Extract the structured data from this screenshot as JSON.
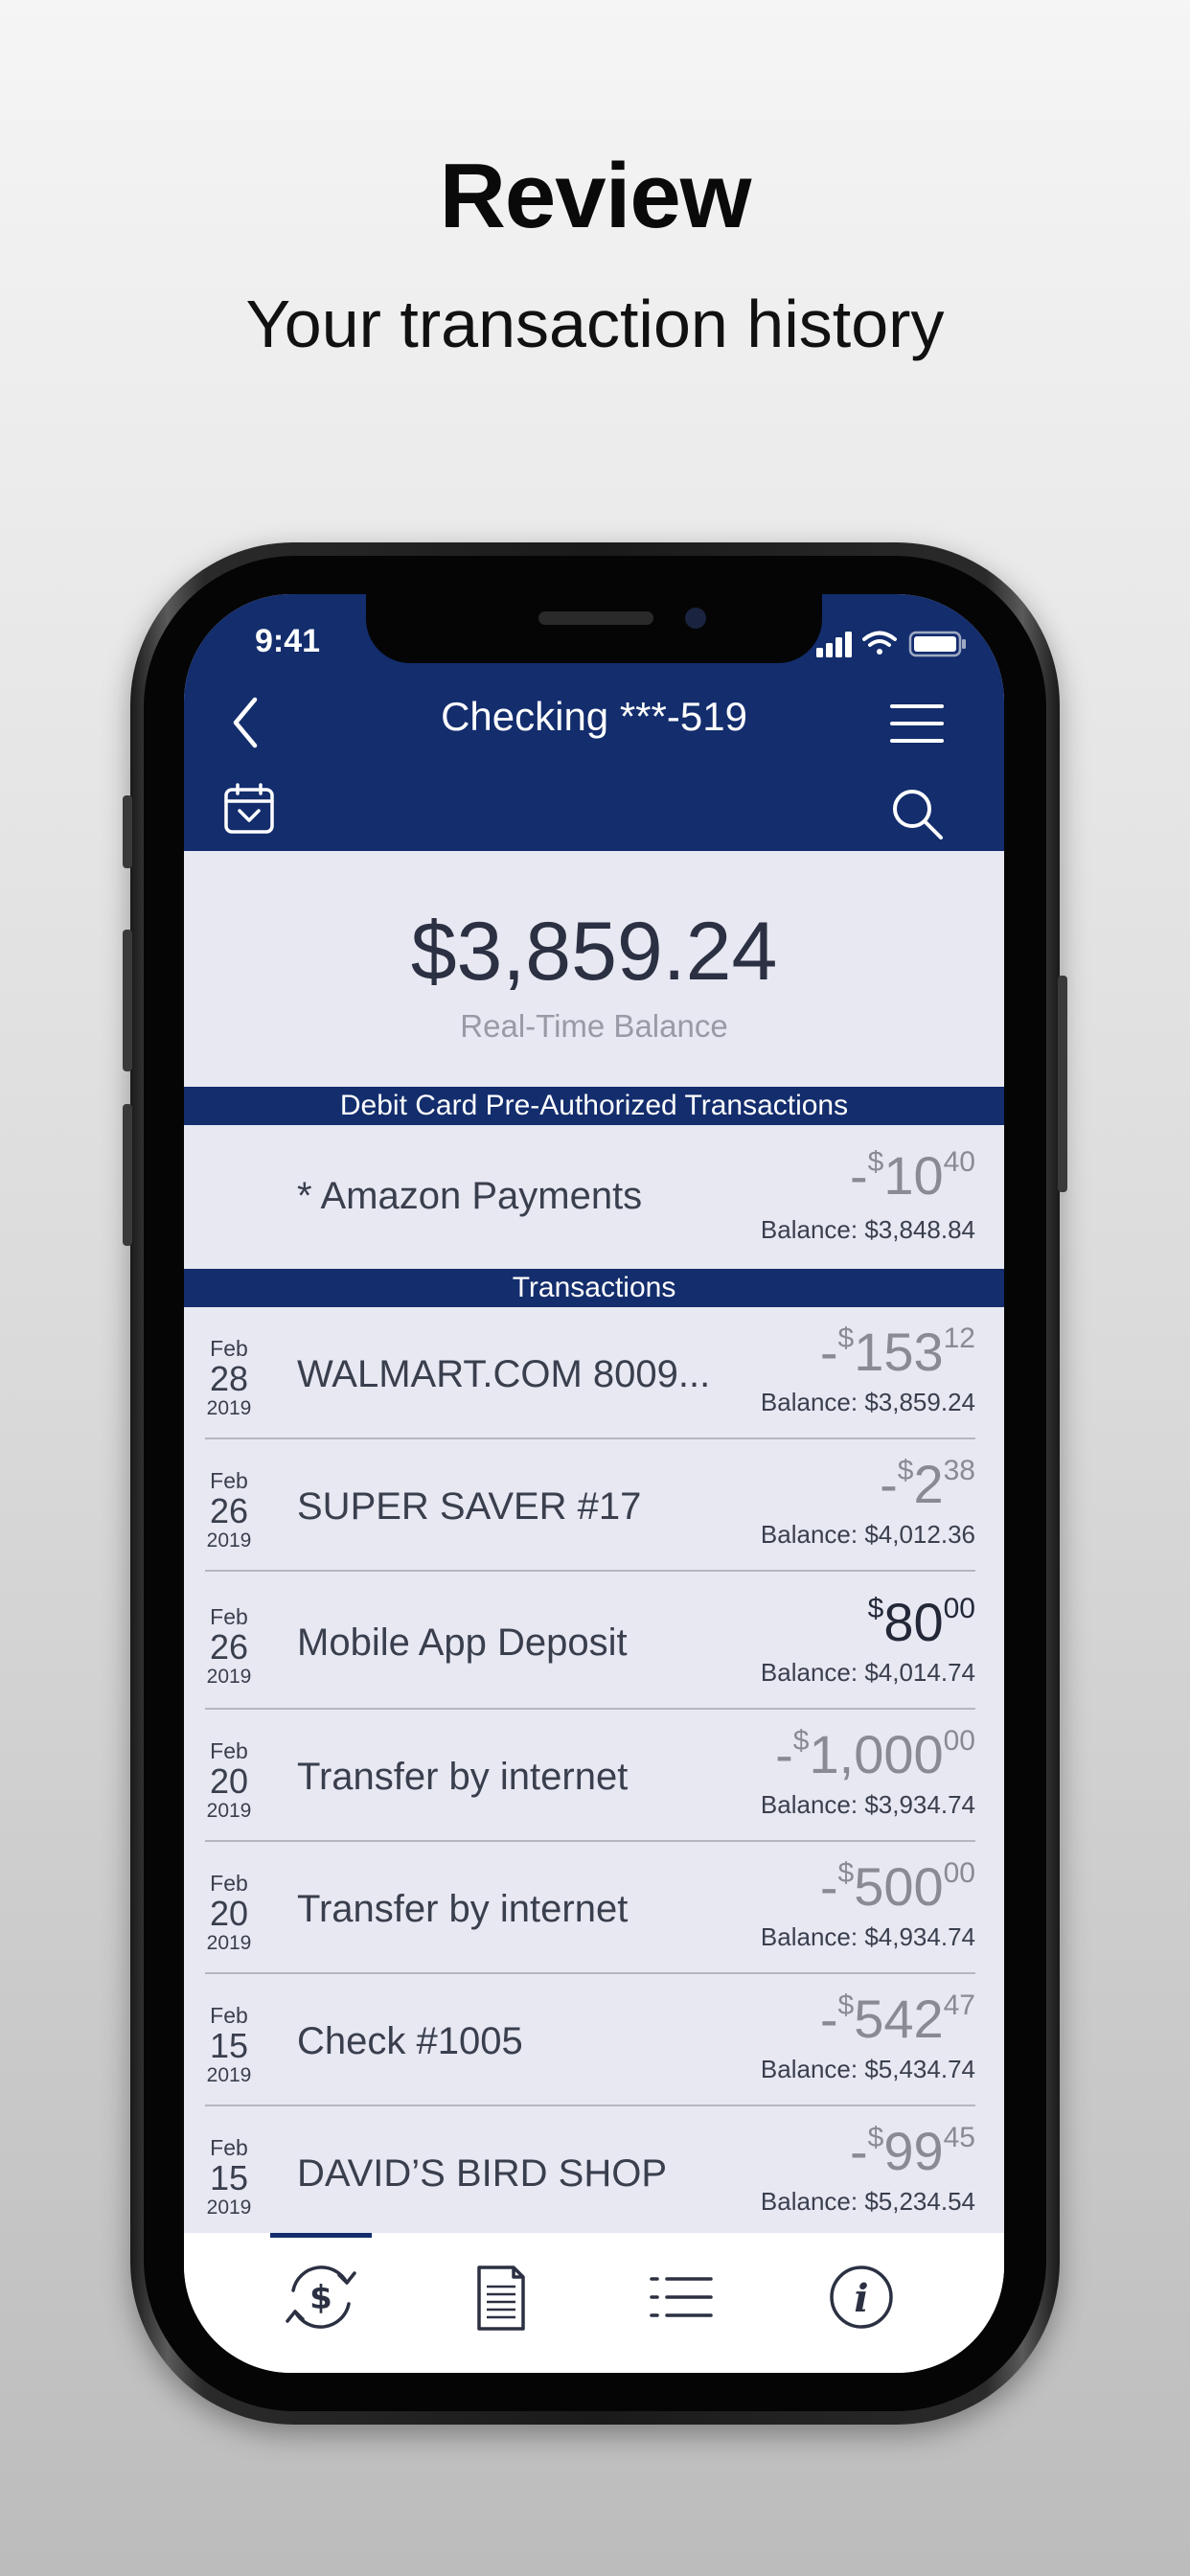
{
  "promo": {
    "title": "Review",
    "subtitle": "Your transaction history"
  },
  "status_bar": {
    "time": "9:41"
  },
  "nav": {
    "title": "Checking ***-519",
    "back_icon": "chevron-left-icon",
    "menu_icon": "hamburger-icon",
    "calendar_icon": "calendar-icon",
    "search_icon": "search-icon"
  },
  "balance": {
    "amount": "$3,859.24",
    "label": "Real-Time Balance"
  },
  "pending": {
    "header": "Debit Card Pre-Authorized Transactions",
    "items": [
      {
        "description": "* Amazon Payments",
        "sign": "-",
        "currency": "$",
        "dollars": "10",
        "cents": "40",
        "balance": "Balance: $3,848.84"
      }
    ]
  },
  "transactions": {
    "header": "Transactions",
    "items": [
      {
        "month": "Feb",
        "day": "28",
        "year": "2019",
        "description": "WALMART.COM 8009...",
        "sign": "-",
        "currency": "$",
        "dollars": "153",
        "cents": "12",
        "balance": "Balance: $3,859.24"
      },
      {
        "month": "Feb",
        "day": "26",
        "year": "2019",
        "description": "SUPER SAVER #17",
        "sign": "-",
        "currency": "$",
        "dollars": "2",
        "cents": "38",
        "balance": "Balance: $4,012.36"
      },
      {
        "month": "Feb",
        "day": "26",
        "year": "2019",
        "description": "Mobile App Deposit",
        "sign": "",
        "currency": "$",
        "dollars": "80",
        "cents": "00",
        "balance": "Balance: $4,014.74"
      },
      {
        "month": "Feb",
        "day": "20",
        "year": "2019",
        "description": "Transfer by internet",
        "sign": "-",
        "currency": "$",
        "dollars": "1,000",
        "cents": "00",
        "balance": "Balance: $3,934.74"
      },
      {
        "month": "Feb",
        "day": "20",
        "year": "2019",
        "description": "Transfer by internet",
        "sign": "-",
        "currency": "$",
        "dollars": "500",
        "cents": "00",
        "balance": "Balance: $4,934.74"
      },
      {
        "month": "Feb",
        "day": "15",
        "year": "2019",
        "description": "Check #1005",
        "sign": "-",
        "currency": "$",
        "dollars": "542",
        "cents": "47",
        "balance": "Balance: $5,434.74"
      },
      {
        "month": "Feb",
        "day": "15",
        "year": "2019",
        "description": "DAVID’S BIRD SHOP",
        "sign": "-",
        "currency": "$",
        "dollars": "99",
        "cents": "45",
        "balance": "Balance: $5,234.54"
      }
    ]
  },
  "tabbar": {
    "tabs": [
      {
        "icon": "dollar-refresh-icon",
        "selected": true
      },
      {
        "icon": "document-icon",
        "selected": false
      },
      {
        "icon": "list-icon",
        "selected": false
      },
      {
        "icon": "info-icon",
        "selected": false
      }
    ]
  },
  "colors": {
    "brand_navy": "#132d6d",
    "list_background": "#e8e8f2",
    "debit_amount": "#8a8a94",
    "credit_amount": "#232838"
  }
}
